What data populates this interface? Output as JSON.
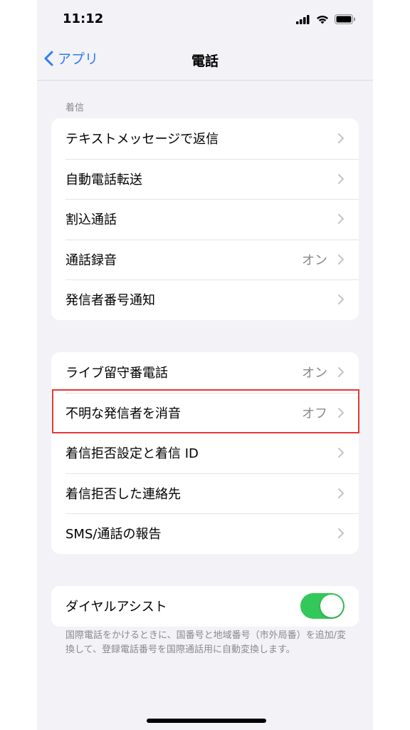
{
  "status_bar": {
    "time": "11:12"
  },
  "nav": {
    "back_label": "アプリ",
    "title": "電話"
  },
  "section_incoming": {
    "header": "着信",
    "rows": [
      {
        "label": "テキストメッセージで返信",
        "value": ""
      },
      {
        "label": "自動電話転送",
        "value": ""
      },
      {
        "label": "割込通話",
        "value": ""
      },
      {
        "label": "通話録音",
        "value": "オン"
      },
      {
        "label": "発信者番号通知",
        "value": ""
      }
    ]
  },
  "section_calls": {
    "rows": [
      {
        "label": "ライブ留守番電話",
        "value": "オン"
      },
      {
        "label": "不明な発信者を消音",
        "value": "オフ"
      },
      {
        "label": "着信拒否設定と着信 ID",
        "value": ""
      },
      {
        "label": "着信拒否した連絡先",
        "value": ""
      },
      {
        "label": "SMS/通話の報告",
        "value": ""
      }
    ]
  },
  "dial_assist": {
    "label": "ダイヤルアシスト",
    "enabled": true,
    "note": "国際電話をかけるときに、国番号と地域番号（市外局番）を追加/変換して、登録電話番号を国際通話用に自動変換します。"
  },
  "colors": {
    "accent": "#2f7cf6",
    "toggle_on": "#34c759",
    "highlight": "#e53935",
    "background": "#f2f2f7",
    "secondary_text": "#8a8a8e"
  }
}
